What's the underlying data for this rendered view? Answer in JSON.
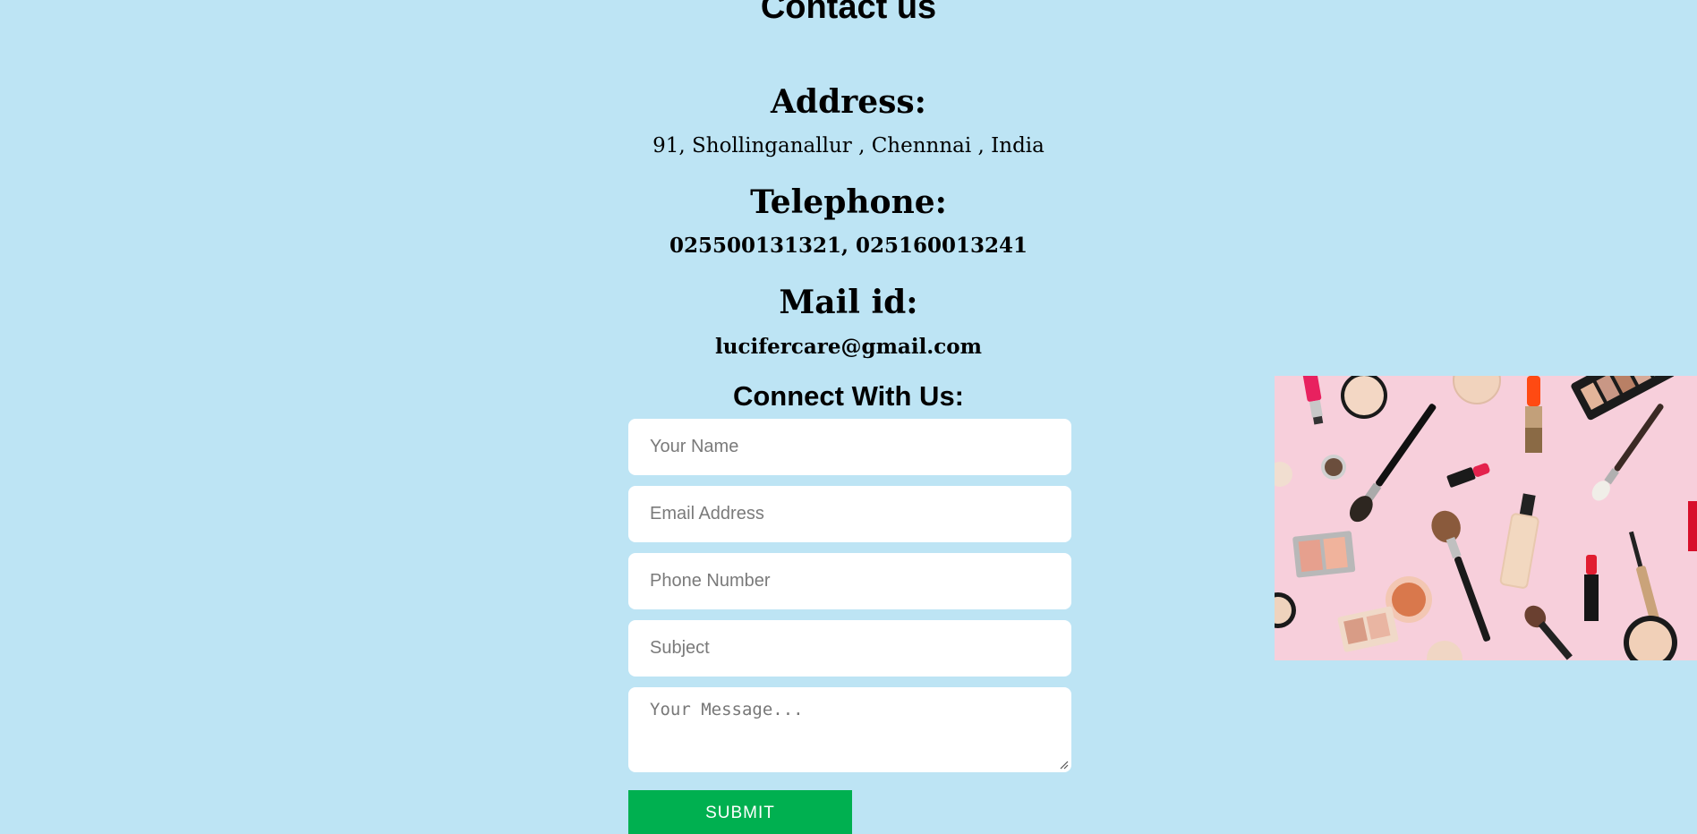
{
  "page": {
    "title": "Contact us"
  },
  "contact": {
    "address_label": "Address:",
    "address_value": "91, Shollinganallur , Chennnai , India",
    "telephone_label": "Telephone:",
    "telephone_value": "025500131321, 025160013241",
    "mail_label": "Mail id:",
    "mail_value": "lucifercare@gmail.com"
  },
  "form": {
    "title": "Connect With Us:",
    "name_placeholder": "Your Name",
    "email_placeholder": "Email Address",
    "phone_placeholder": "Phone Number",
    "subject_placeholder": "Subject",
    "message_placeholder": "Your Message...",
    "submit_label": "SUBMIT"
  },
  "colors": {
    "background": "#bde4f4",
    "submit_button": "#00b050",
    "field_background": "#ffffff"
  },
  "image": {
    "description_icon": "cosmetics-flatlay-image"
  }
}
